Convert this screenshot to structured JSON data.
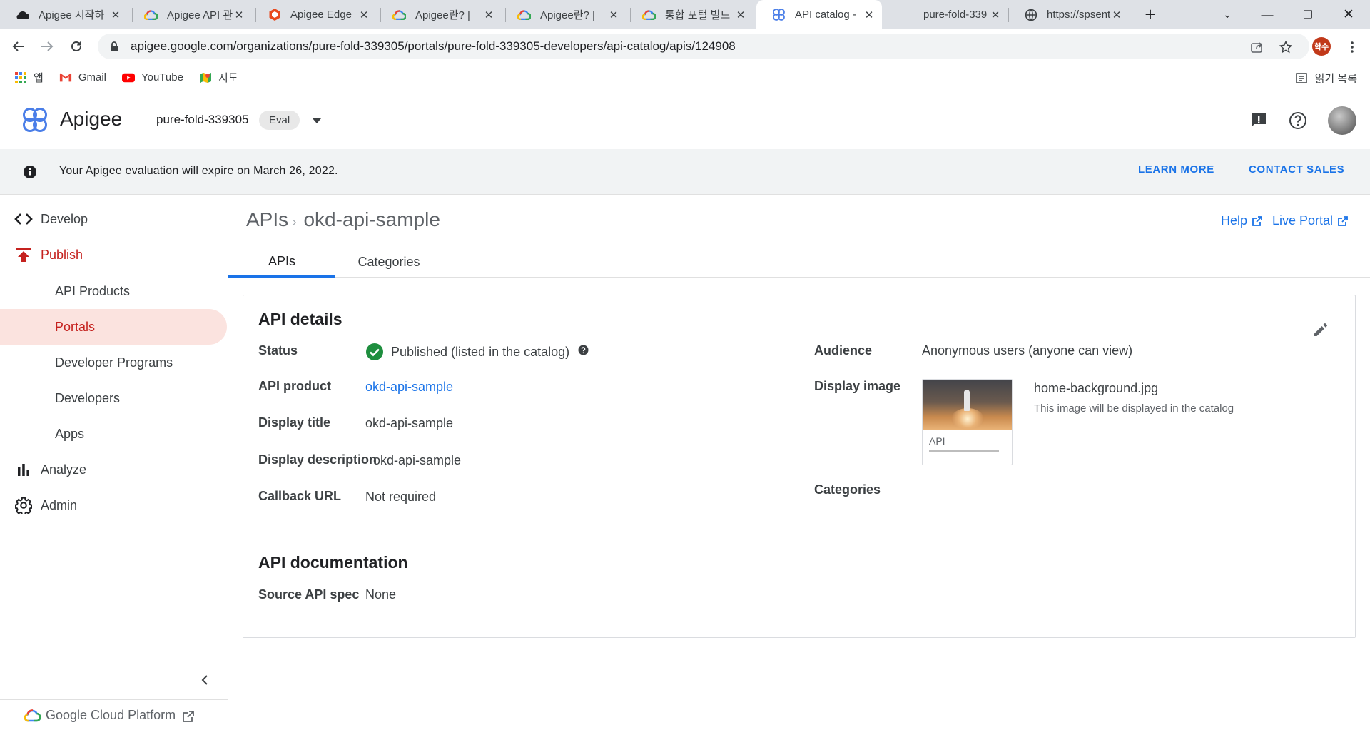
{
  "browser": {
    "tabs": [
      {
        "title": "Apigee 시작하",
        "favicon": "cloud-black"
      },
      {
        "title": "Apigee API 관",
        "favicon": "google-cloud"
      },
      {
        "title": "Apigee Edge",
        "favicon": "orange-hex"
      },
      {
        "title": "Apigee란? |",
        "favicon": "google-cloud"
      },
      {
        "title": "Apigee란? |",
        "favicon": "google-cloud"
      },
      {
        "title": "통합 포털 빌드",
        "favicon": "google-cloud"
      },
      {
        "title": "API catalog -",
        "favicon": "apigee",
        "active": true
      },
      {
        "title": "pure-fold-339",
        "favicon": "none"
      },
      {
        "title": "https://spsent",
        "favicon": "globe"
      }
    ],
    "url": "apigee.google.com/organizations/pure-fold-339305/portals/pure-fold-339305-developers/api-catalog/apis/124908",
    "profile_initials": "학수",
    "bookmarks": [
      {
        "label": "앱",
        "icon": "apps-grid-icon"
      },
      {
        "label": "Gmail",
        "icon": "gmail-icon"
      },
      {
        "label": "YouTube",
        "icon": "youtube-icon"
      },
      {
        "label": "지도",
        "icon": "maps-icon"
      }
    ],
    "reading_list": "읽기 목록"
  },
  "header": {
    "brand": "Apigee",
    "project": "pure-fold-339305",
    "project_badge": "Eval"
  },
  "banner": {
    "message": "Your Apigee evaluation will expire on March 26, 2022.",
    "learn_more": "LEARN MORE",
    "contact_sales": "CONTACT SALES"
  },
  "sidebar": {
    "items": [
      {
        "label": "Develop",
        "icon": "code-brackets-icon"
      },
      {
        "label": "Publish",
        "icon": "publish-icon"
      },
      {
        "label": "API Products"
      },
      {
        "label": "Portals"
      },
      {
        "label": "Developer Programs"
      },
      {
        "label": "Developers"
      },
      {
        "label": "Apps"
      },
      {
        "label": "Analyze",
        "icon": "bar-chart-icon"
      },
      {
        "label": "Admin",
        "icon": "gear-icon"
      }
    ],
    "footer": "Google Cloud Platform"
  },
  "main": {
    "breadcrumb": [
      "APIs",
      "okd-api-sample"
    ],
    "help": "Help",
    "live_portal": "Live Portal",
    "tabs": [
      "APIs",
      "Categories"
    ],
    "details": {
      "title": "API details",
      "status_label": "Status",
      "status_value": "Published (listed in the catalog)",
      "api_product_label": "API product",
      "api_product_value": "okd-api-sample",
      "display_title_label": "Display title",
      "display_title_value": "okd-api-sample",
      "display_description_label": "Display description",
      "display_description_value": "okd-api-sample",
      "callback_label": "Callback URL",
      "callback_value": "Not required",
      "audience_label": "Audience",
      "audience_value": "Anonymous users (anyone can view)",
      "display_image_label": "Display image",
      "image_card_label": "API",
      "image_name": "home-background.jpg",
      "image_hint": "This image will be displayed in the catalog",
      "categories_label": "Categories"
    },
    "documentation": {
      "title": "API documentation",
      "source_label": "Source API spec",
      "source_value": "None"
    }
  },
  "colors": {
    "accent": "#1a73e8",
    "publish_red": "#c5221f",
    "selected_bg": "#fbe3df",
    "status_green": "#1e8e3e"
  }
}
